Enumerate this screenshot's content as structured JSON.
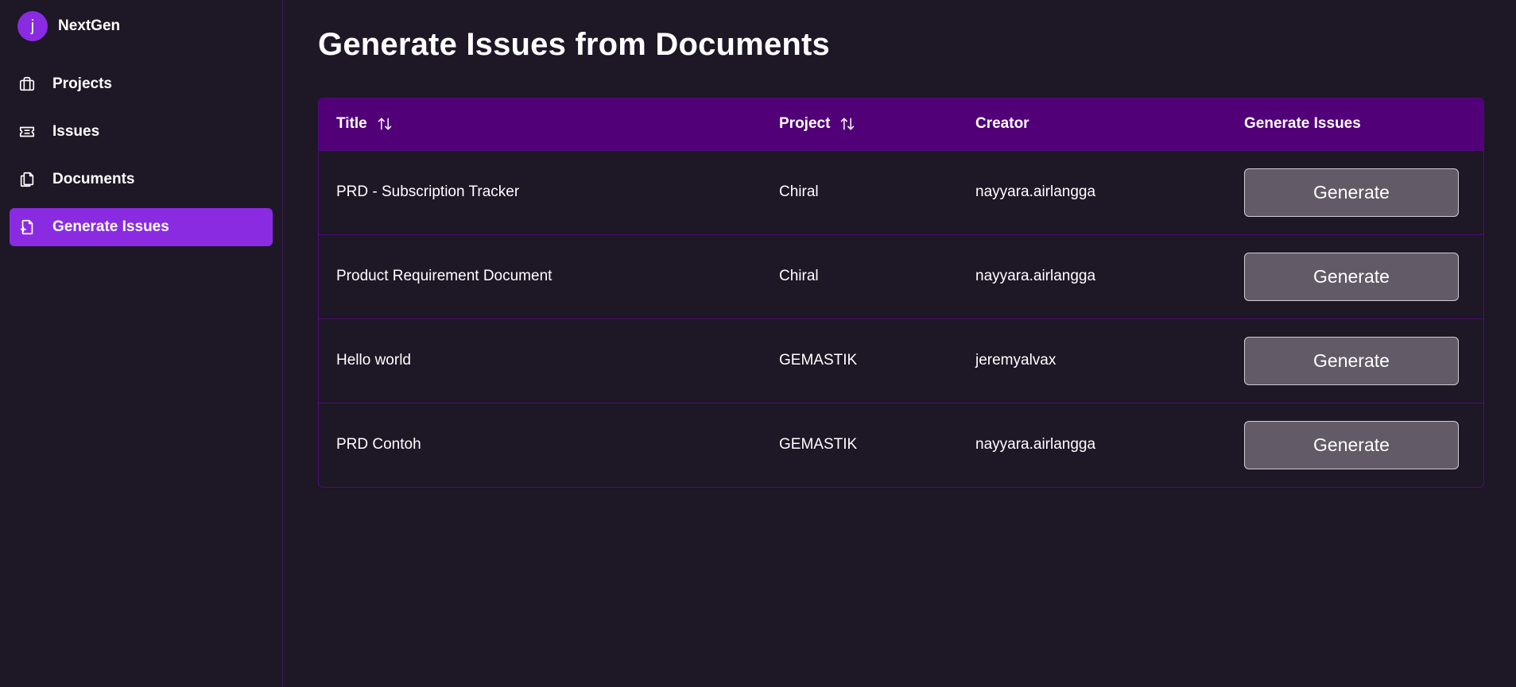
{
  "brand": {
    "avatar_letter": "j",
    "name": "NextGen"
  },
  "sidebar": {
    "items": [
      {
        "label": "Projects",
        "icon": "briefcase-icon"
      },
      {
        "label": "Issues",
        "icon": "ticket-icon"
      },
      {
        "label": "Documents",
        "icon": "documents-icon"
      },
      {
        "label": "Generate Issues",
        "icon": "file-plus-icon",
        "active": true
      }
    ]
  },
  "main": {
    "title": "Generate Issues from Documents",
    "table": {
      "headers": {
        "title": "Title",
        "project": "Project",
        "creator": "Creator",
        "generate": "Generate Issues"
      },
      "rows": [
        {
          "title": "PRD - Subscription Tracker",
          "project": "Chiral",
          "creator": "nayyara.airlangga",
          "button": "Generate"
        },
        {
          "title": "Product Requirement Document",
          "project": "Chiral",
          "creator": "nayyara.airlangga",
          "button": "Generate"
        },
        {
          "title": "Hello world",
          "project": "GEMASTIK",
          "creator": "jeremyalvax",
          "button": "Generate"
        },
        {
          "title": "PRD Contoh",
          "project": "GEMASTIK",
          "creator": "nayyara.airlangga",
          "button": "Generate"
        }
      ]
    }
  },
  "colors": {
    "background": "#1e1726",
    "accent": "#8a2be2",
    "table_header": "#510077",
    "button": "#625a66"
  }
}
